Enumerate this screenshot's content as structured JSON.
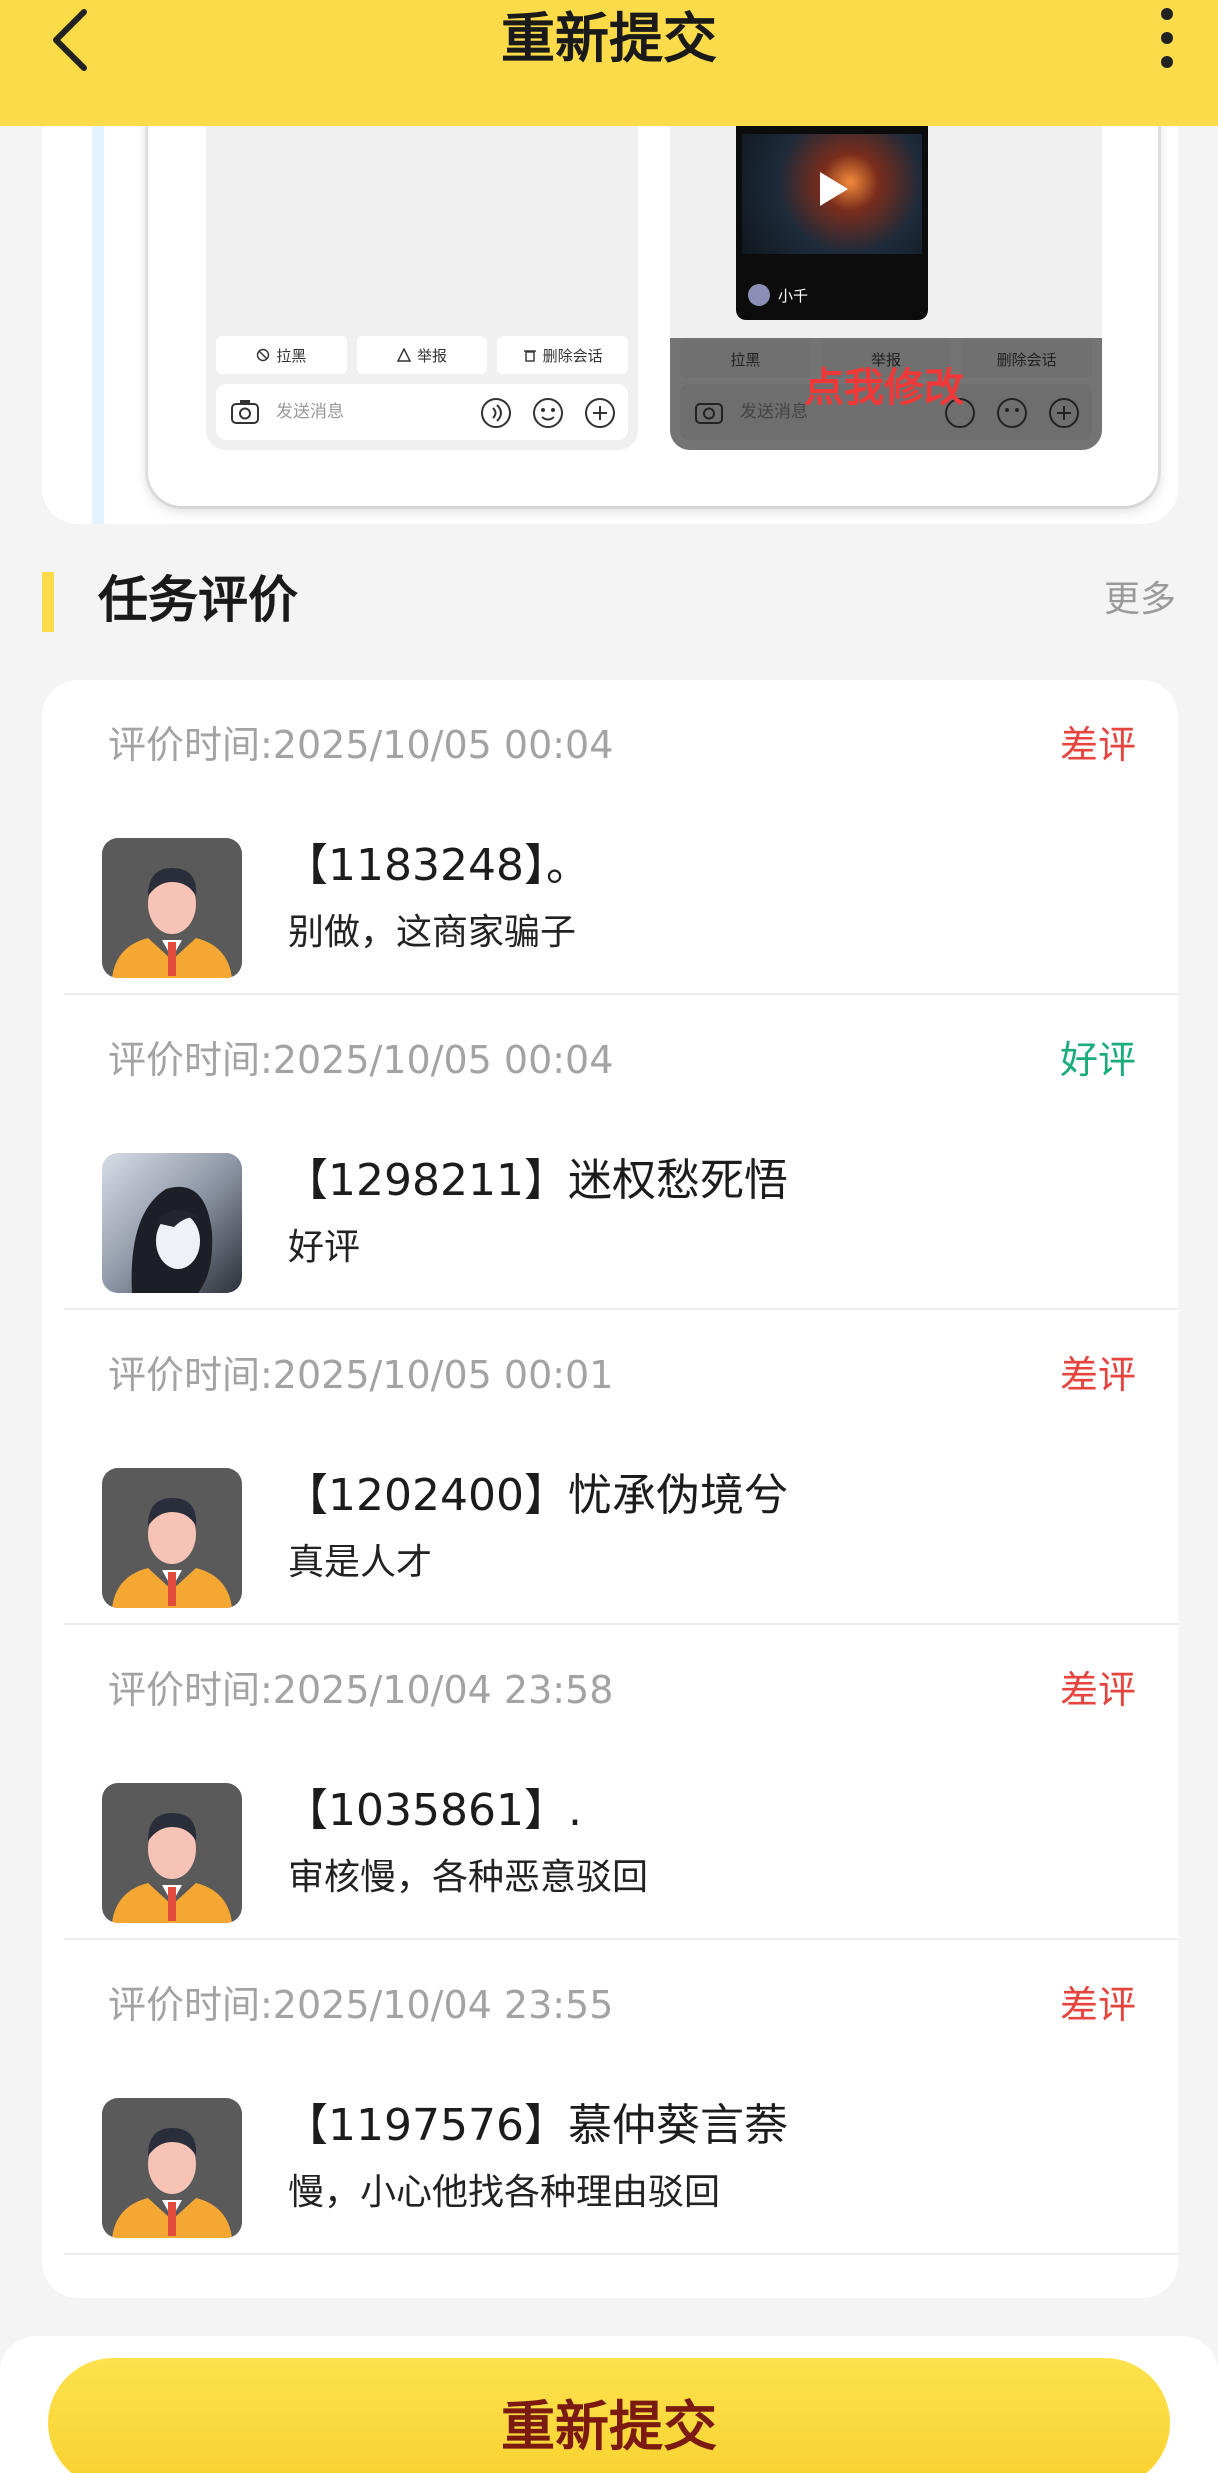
{
  "header": {
    "title": "重新提交",
    "back_icon": "chevron-left-icon",
    "more_icon": "more-vertical-icon"
  },
  "example": {
    "actions": [
      "拉黑",
      "举报",
      "删除会话"
    ],
    "input_placeholder": "发送消息",
    "video_author": "小千",
    "edit_hint": "点我修改"
  },
  "section": {
    "title": "任务评价",
    "more": "更多"
  },
  "reviews": [
    {
      "time": "评价时间:2025/10/05 00:04",
      "rating": "差评",
      "rating_type": "bad",
      "name": "【1183248】。",
      "comment": "别做，这商家骗子",
      "avatar": "default-avatar"
    },
    {
      "time": "评价时间:2025/10/05 00:04",
      "rating": "好评",
      "rating_type": "good",
      "name": "【1298211】迷权愁死悟",
      "comment": "好评",
      "avatar": "anime-avatar"
    },
    {
      "time": "评价时间:2025/10/05 00:01",
      "rating": "差评",
      "rating_type": "bad",
      "name": "【1202400】忧承伪境兮",
      "comment": "真是人才",
      "avatar": "default-avatar"
    },
    {
      "time": "评价时间:2025/10/04 23:58",
      "rating": "差评",
      "rating_type": "bad",
      "name": "【1035861】.",
      "comment": "审核慢，各种恶意驳回",
      "avatar": "default-avatar"
    },
    {
      "time": "评价时间:2025/10/04 23:55",
      "rating": "差评",
      "rating_type": "bad",
      "name": "【1197576】慕仲葵言萘",
      "comment": "慢，小心他找各种理由驳回",
      "avatar": "default-avatar"
    }
  ],
  "footer": {
    "submit_label": "重新提交"
  },
  "colors": {
    "brand_yellow": "#fbdb4a",
    "bad_rating": "#e6453f",
    "good_rating": "#1aad7a",
    "edit_hint": "#f03838"
  }
}
